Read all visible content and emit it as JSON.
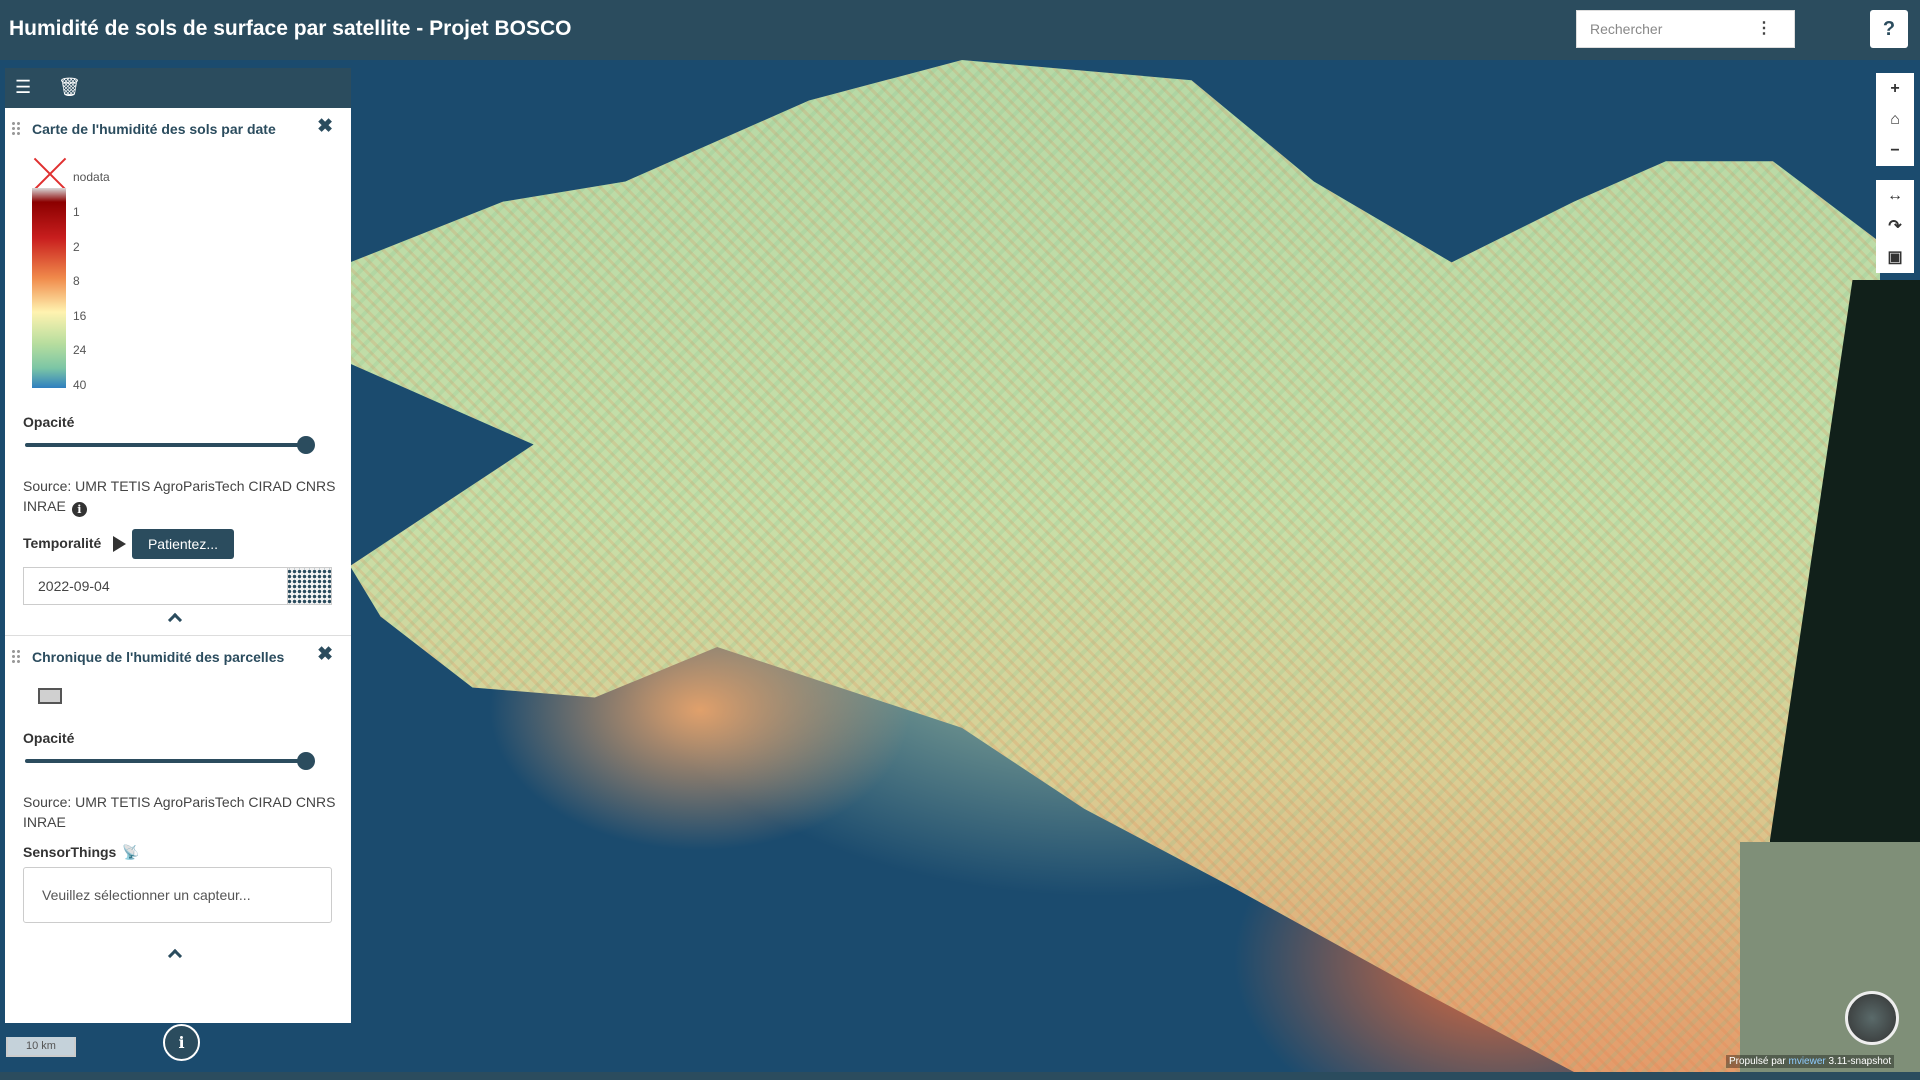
{
  "header": {
    "title": "Humidité de sols de surface par satellite - Projet BOSCO",
    "search_placeholder": "Rechercher",
    "help_label": "?"
  },
  "toolbar": {
    "list_icon": "list-icon",
    "trash_icon": "trash-icon"
  },
  "layer1": {
    "title": "Carte de l'humidité des sols par date",
    "legend": {
      "nodata_label": "nodata",
      "ticks": [
        "1",
        "2",
        "8",
        "16",
        "24",
        "40"
      ],
      "colors": [
        "#8b0000",
        "#c81e1e",
        "#f08a4b",
        "#fff3b0",
        "#b6dd9e",
        "#2f7fbf"
      ]
    },
    "opacity_label": "Opacité",
    "opacity_value": 1.0,
    "source_line1": "Source: UMR TETIS AgroParisTech CIRAD CNRS",
    "source_line2": "INRAE",
    "temporal_label": "Temporalité",
    "wait_button": "Patientez...",
    "date_value": "2022-09-04"
  },
  "layer2": {
    "title": "Chronique de l'humidité des parcelles",
    "opacity_label": "Opacité",
    "opacity_value": 1.0,
    "source_line1": "Source: UMR TETIS AgroParisTech CIRAD CNRS",
    "source_line2": "INRAE",
    "sensor_label": "SensorThings",
    "sensor_placeholder": "Veuillez sélectionner un capteur..."
  },
  "map": {
    "scale_label": "10 km",
    "info_label": "i",
    "credit_prefix": "Propulsé par",
    "credit_link": "mviewer",
    "credit_version": "3.11-snapshot",
    "controls": [
      "+",
      "⌂",
      "−",
      "↔",
      "↷",
      "▣"
    ]
  }
}
